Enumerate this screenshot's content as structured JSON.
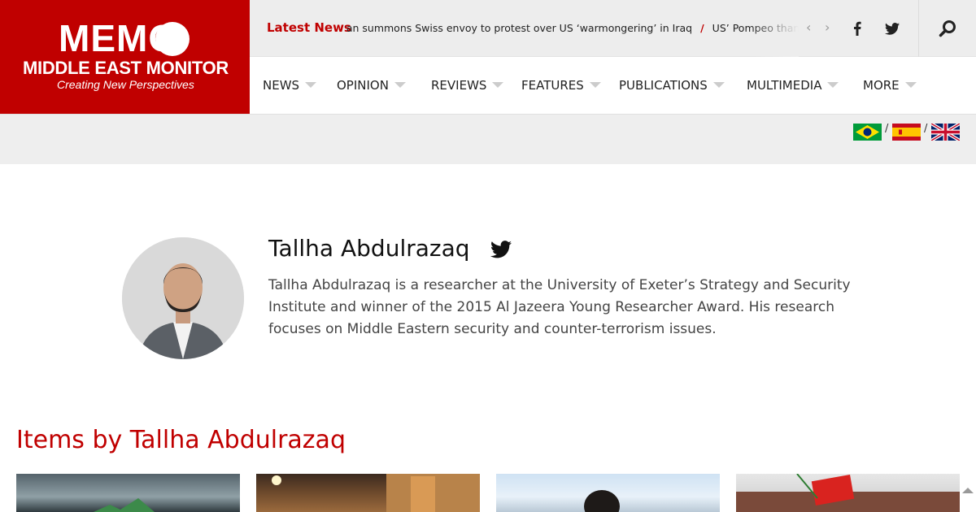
{
  "header": {
    "logo": {
      "wordmark": "MEMO",
      "name": "MIDDLE EAST MONITOR",
      "tagline": "Creating New Perspectives",
      "background": "#c00000"
    },
    "ticker": {
      "label": "Latest News",
      "items": [
        "Iran summons Swiss envoy to protest over US ‘warmongering’ in Iraq",
        "US’ Pompeo thanks Israel’s Netanyahu"
      ],
      "separator": "/",
      "prev_icon": "chevron-left-icon",
      "next_icon": "chevron-right-icon"
    },
    "social": [
      "facebook-icon",
      "twitter-icon"
    ],
    "search_icon": "search-icon"
  },
  "nav": {
    "items": [
      {
        "label": "NEWS"
      },
      {
        "label": "OPINION"
      },
      {
        "label": "REVIEWS"
      },
      {
        "label": "FEATURES"
      },
      {
        "label": "PUBLICATIONS"
      },
      {
        "label": "MULTIMEDIA"
      },
      {
        "label": "MORE"
      }
    ]
  },
  "languages": {
    "separator": "/",
    "flags": [
      "brazil-flag-icon",
      "spain-flag-icon",
      "uk-flag-icon"
    ]
  },
  "author": {
    "name": "Tallha Abdulrazaq",
    "bio": "Tallha Abdulrazaq is a researcher at the University of Exeter’s Strategy and Security Institute and winner of the 2015 Al Jazeera Young Researcher Award. His research focuses on Middle Eastern security and counter-terrorism issues.",
    "twitter_icon": "twitter-icon"
  },
  "items_section": {
    "title": "Items by Tallha Abdulrazaq",
    "cards": 4
  },
  "colors": {
    "accent": "#c00000",
    "ticker_bg": "#ededed",
    "lang_bar_bg": "#eeeeee"
  }
}
